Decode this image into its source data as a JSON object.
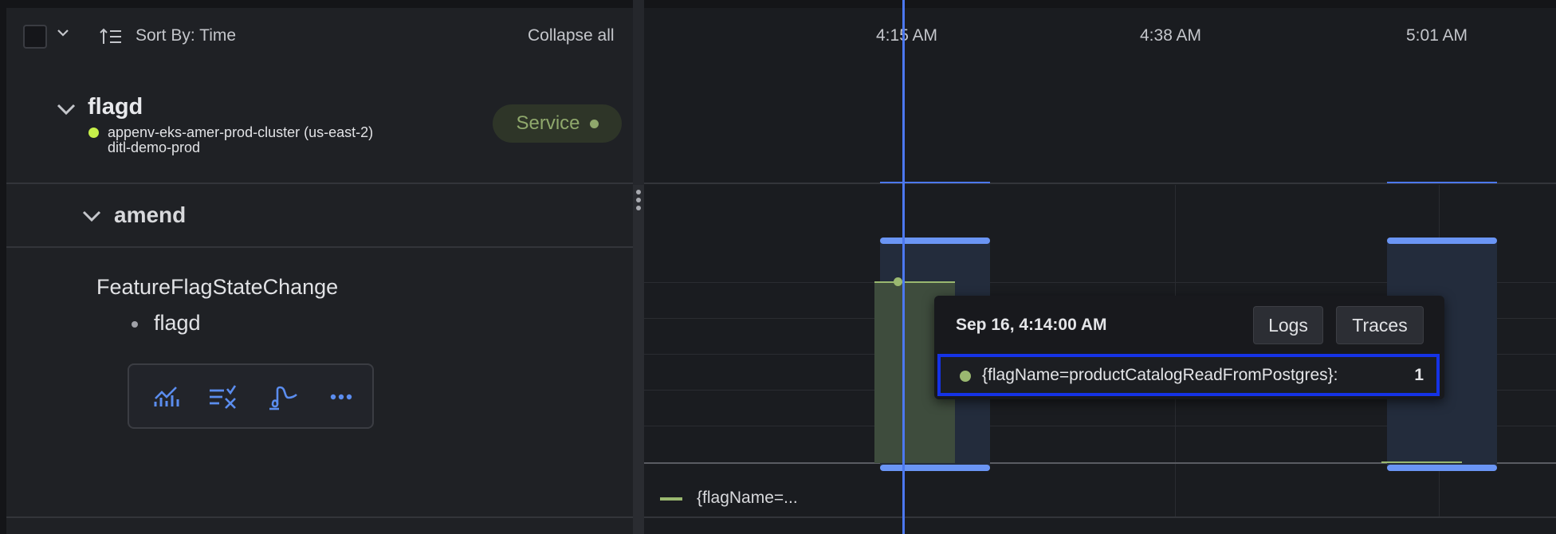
{
  "toolbar": {
    "sort_label": "Sort By: Time",
    "collapse_all": "Collapse all"
  },
  "service": {
    "name": "flagd",
    "cluster": "appenv-eks-amer-prod-cluster (us-east-2)",
    "namespace": "ditl-demo-prod",
    "badge": "Service",
    "status_color": "#c7f04a"
  },
  "group": {
    "name": "amend"
  },
  "event": {
    "name": "FeatureFlagStateChange",
    "bullet": "flagd",
    "actions": [
      "chart-icon",
      "filter-x-icon",
      "function-icon",
      "more-icon"
    ]
  },
  "timeline": {
    "ticks": [
      "4:15 AM",
      "4:38 AM",
      "5:01 AM"
    ],
    "legend": "{flagName=...",
    "series_color": "#9ab870",
    "highlight_color": "#4c78f0"
  },
  "tooltip": {
    "timestamp": "Sep 16, 4:14:00 AM",
    "logs_label": "Logs",
    "traces_label": "Traces",
    "series": "{flagName=productCatalogReadFromPostgres}:",
    "value": "1"
  }
}
